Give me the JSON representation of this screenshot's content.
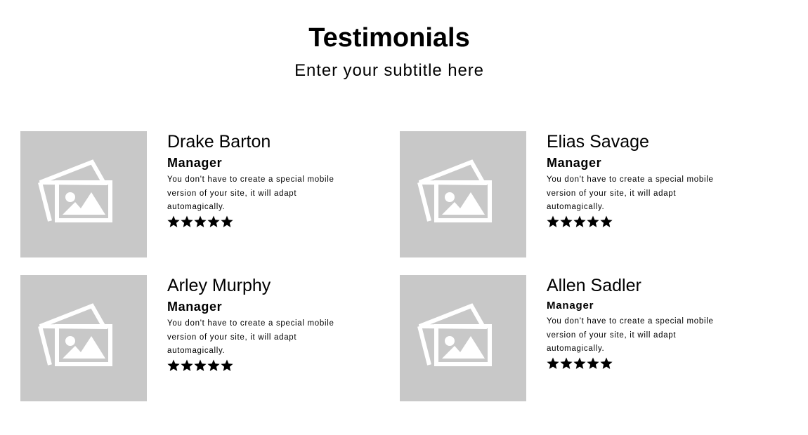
{
  "header": {
    "title": "Testimonials",
    "subtitle": "Enter your subtitle here"
  },
  "testimonials": [
    {
      "name": "Drake Barton",
      "role": "Manager",
      "quote": "You don't have to create a special mobile version of your site, it will adapt automagically.",
      "rating": 5,
      "photo_icon": "image-placeholder-icon"
    },
    {
      "name": "Elias Savage",
      "role": "Manager",
      "quote": "You don't have to create a special mobile version of your site, it will adapt automagically.",
      "rating": 5,
      "photo_icon": "image-placeholder-icon"
    },
    {
      "name": "Arley Murphy",
      "role": "Manager",
      "quote": "You don't have to create a special mobile version of your site, it will adapt automagically.",
      "rating": 5,
      "photo_icon": "image-placeholder-icon"
    },
    {
      "name": "Allen Sadler",
      "role": "Manager",
      "quote": "You don't have to create a special mobile version of your site, it will adapt automagically.",
      "rating": 5,
      "photo_icon": "image-placeholder-icon"
    }
  ],
  "colors": {
    "placeholder_bg": "#c8c8c8",
    "placeholder_icon": "#ffffff",
    "text": "#000000",
    "star": "#000000"
  }
}
